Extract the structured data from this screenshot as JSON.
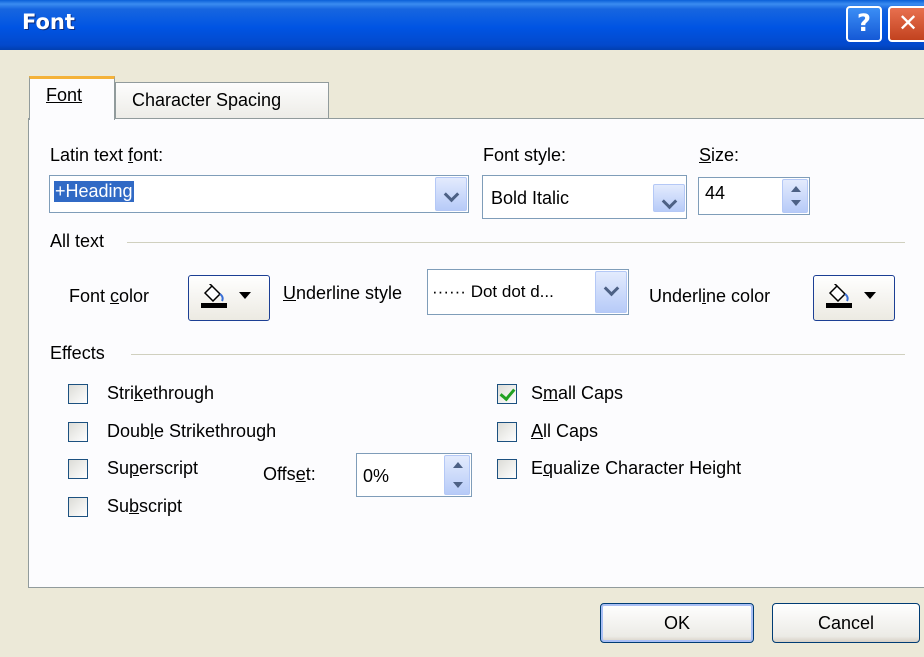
{
  "window": {
    "title": "Font"
  },
  "titlebar": {
    "help_glyph": "?",
    "close_glyph": "✕"
  },
  "tabs": [
    {
      "label": "Font",
      "active": true
    },
    {
      "label": "Character Spacing",
      "active": false
    }
  ],
  "latin_font": {
    "label_pre": "Latin text ",
    "label_key": "f",
    "label_post": "ont:",
    "value": "+Heading"
  },
  "font_style": {
    "label": "Font style:",
    "value": "Bold Italic"
  },
  "size": {
    "label_key": "S",
    "label_post": "ize:",
    "value": "44"
  },
  "all_text": {
    "heading": "All text",
    "font_color": {
      "label_pre": "Font ",
      "label_key": "c",
      "label_post": "olor"
    },
    "underline_style": {
      "label_key": "U",
      "label_post": "nderline style",
      "value": "······ Dot dot d..."
    },
    "underline_color": {
      "label_pre": "Underl",
      "label_key": "i",
      "label_post": "ne color"
    }
  },
  "effects": {
    "heading": "Effects",
    "strikethrough": {
      "pre": "Stri",
      "key": "k",
      "post": "ethrough",
      "checked": false
    },
    "double_strikethrough": {
      "pre": "Doub",
      "key": "l",
      "post": "e Strikethrough",
      "checked": false
    },
    "superscript": {
      "pre": "Su",
      "key": "p",
      "post": "erscript",
      "checked": false
    },
    "subscript": {
      "pre": "Su",
      "key": "b",
      "post": "script",
      "checked": false
    },
    "offset": {
      "pre": "Offs",
      "key": "e",
      "post": "t:",
      "value": "0%"
    },
    "small_caps": {
      "pre": "S",
      "key": "m",
      "post": "all Caps",
      "checked": true
    },
    "all_caps": {
      "pre": "",
      "key": "A",
      "post": "ll Caps",
      "checked": false
    },
    "equalize": {
      "pre": "E",
      "key": "q",
      "post": "ualize Character Height",
      "checked": false
    }
  },
  "buttons": {
    "ok": "OK",
    "cancel": "Cancel"
  },
  "colors": {
    "titlebar": "#0054e3",
    "selection": "#316ac5",
    "check": "#21a121",
    "tab_highlight": "#f4b23a"
  }
}
